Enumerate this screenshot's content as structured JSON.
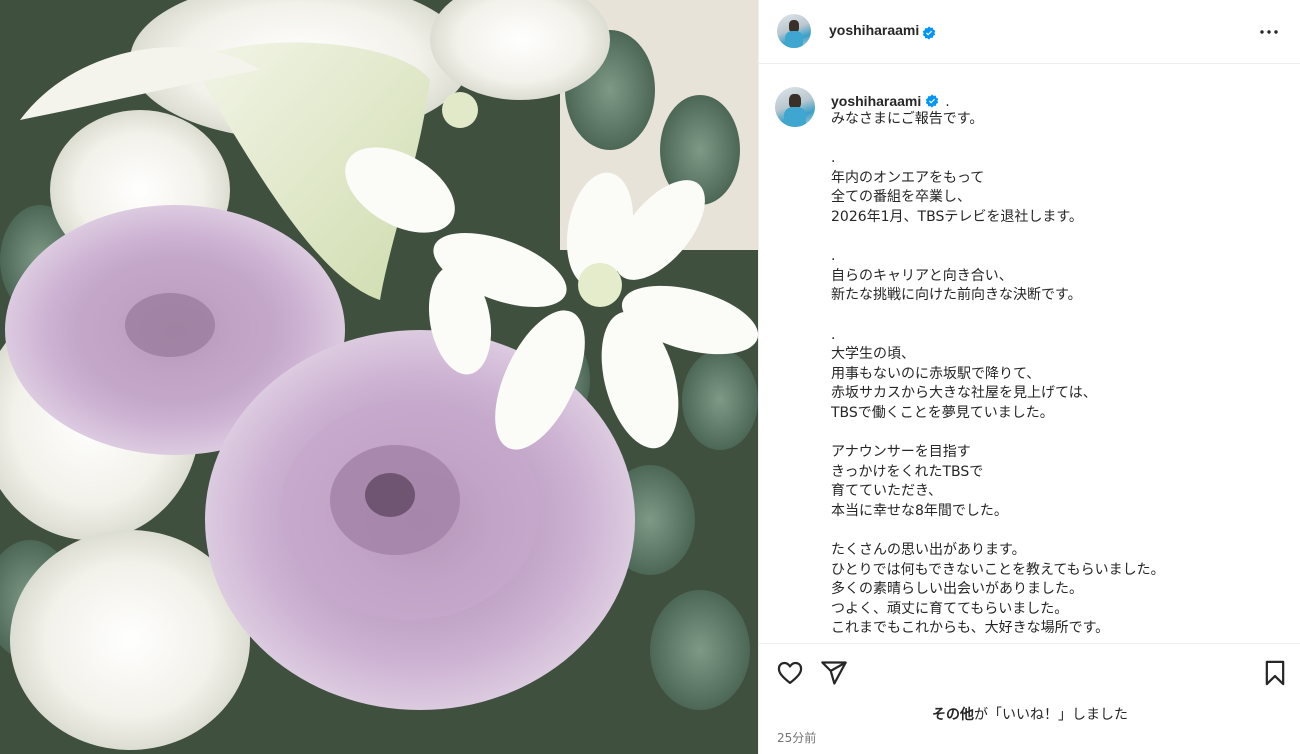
{
  "post": {
    "username": "yoshiharaami",
    "caption_dot": ".",
    "caption_lines": [
      "みなさまにご報告です。",
      "",
      ".",
      "年内のオンエアをもって",
      "全ての番組を卒業し、",
      "2026年1月、TBSテレビを退社します。",
      "",
      ".",
      "自らのキャリアと向き合い、",
      "新たな挑戦に向けた前向きな決断です。",
      "",
      ".",
      "大学生の頃、",
      "用事もないのに赤坂駅で降りて、",
      "赤坂サカスから大きな社屋を見上げては、",
      "TBSで働くことを夢見ていました。",
      "",
      "アナウンサーを目指す",
      "きっかけをくれたTBSで",
      "育てていただき、",
      "本当に幸せな8年間でした。",
      "",
      "たくさんの思い出があります。",
      "ひとりでは何もできないことを教えてもらいました。",
      "多くの素晴らしい出会いがありました。",
      "つよく、頑丈に育ててもらいました。",
      "これまでもこれからも、大好きな場所です。"
    ],
    "likes_bold": "その他",
    "likes_text": "が「いいね！」しました",
    "timestamp": "25分前"
  },
  "icons": {
    "verified": "verified-badge-icon",
    "more": "more-options-icon",
    "like": "heart-icon",
    "share": "paper-plane-icon",
    "save": "bookmark-icon"
  },
  "colors": {
    "verified": "#0095f6",
    "text": "#262626",
    "muted": "#737373",
    "border": "#efefef"
  }
}
